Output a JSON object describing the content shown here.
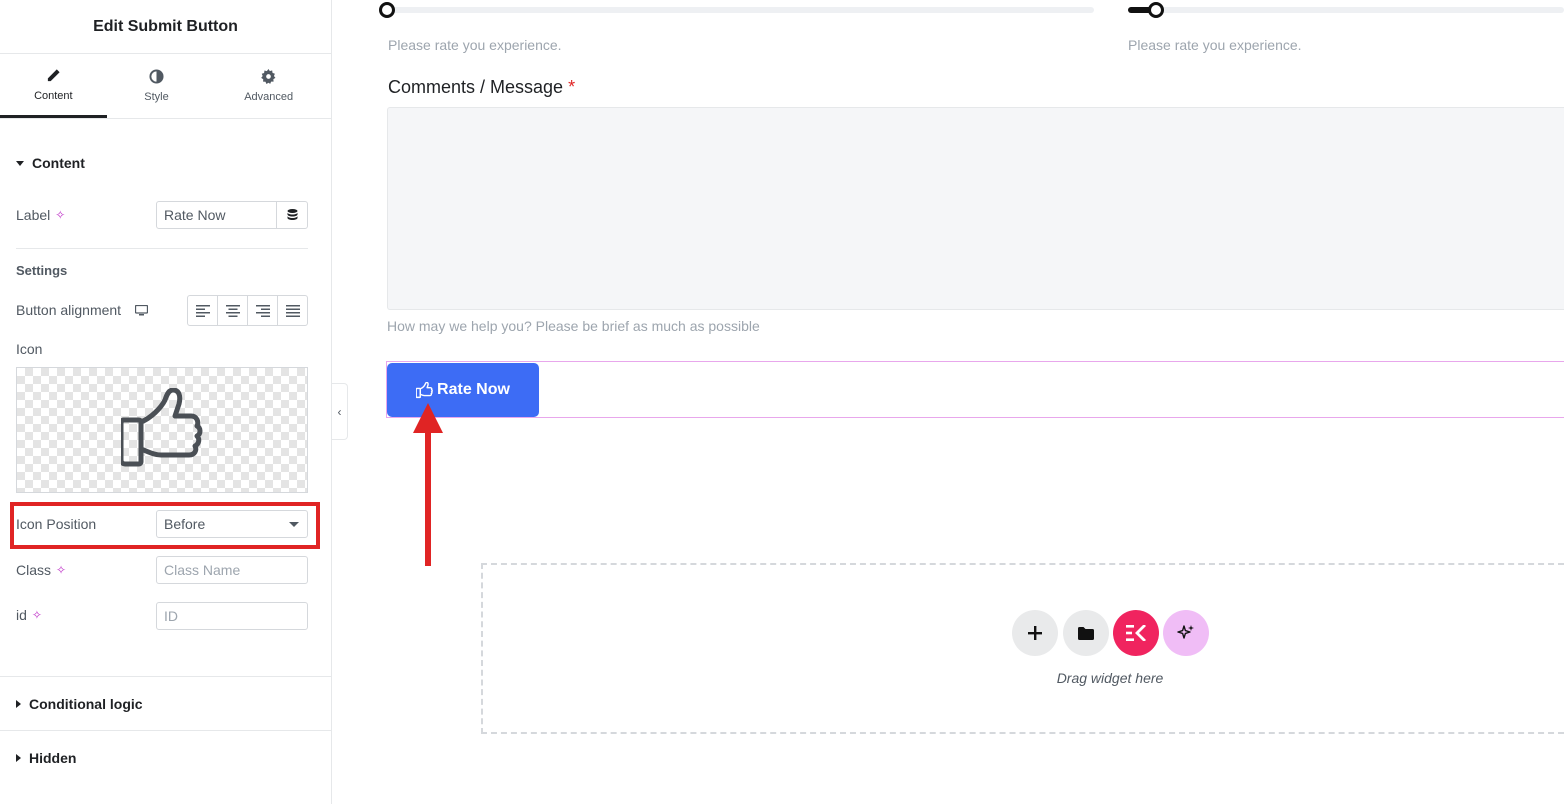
{
  "panel": {
    "title": "Edit Submit Button",
    "tabs": [
      {
        "label": "Content",
        "icon": "pencil-icon",
        "active": true
      },
      {
        "label": "Style",
        "icon": "half-circle-icon",
        "active": false
      },
      {
        "label": "Advanced",
        "icon": "gear-icon",
        "active": false
      }
    ],
    "content_section": "Content",
    "label_field": {
      "label": "Label",
      "value": "Rate Now"
    },
    "settings_heading": "Settings",
    "button_alignment_label": "Button alignment",
    "icon_label": "Icon",
    "icon_position": {
      "label": "Icon Position",
      "value": "Before"
    },
    "class_field": {
      "label": "Class",
      "placeholder": "Class Name"
    },
    "id_field": {
      "label": "id",
      "placeholder": "ID"
    },
    "conditional_logic": "Conditional logic",
    "hidden": "Hidden"
  },
  "canvas": {
    "slider_help_1": "Please rate you experience.",
    "slider_help_2": "Please rate you experience.",
    "comments_label": "Comments / Message",
    "required_mark": "*",
    "comments_help": "How may we help you? Please be brief as much as possible",
    "submit_button_label": "Rate Now",
    "drag_text": "Drag widget here"
  },
  "colors": {
    "accent_blue": "#3d6cf5",
    "highlight_red": "#e02424",
    "elementor_pink": "#f0245f",
    "ai_lilac": "#f0bdf6"
  }
}
